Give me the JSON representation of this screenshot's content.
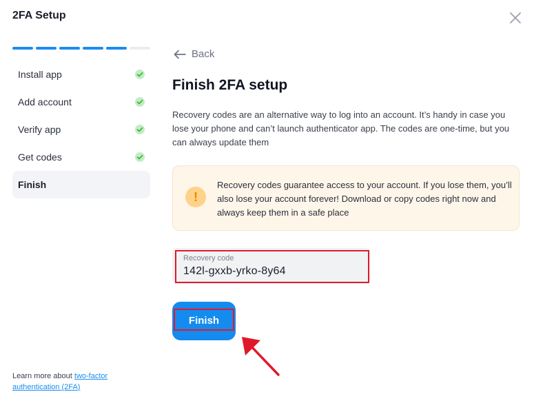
{
  "modal": {
    "title": "2FA Setup"
  },
  "progress": {
    "segments_total": 6,
    "segments_done": 5,
    "accent": "#1a8cf0"
  },
  "steps": [
    {
      "label": "Install app",
      "done": true
    },
    {
      "label": "Add account",
      "done": true
    },
    {
      "label": "Verify app",
      "done": true
    },
    {
      "label": "Get codes",
      "done": true
    },
    {
      "label": "Finish",
      "done": false,
      "active": true
    }
  ],
  "learn_more": {
    "prefix": "Learn more about ",
    "link": "two-factor authentication (2FA)"
  },
  "main": {
    "back_label": "Back",
    "title": "Finish 2FA setup",
    "description": "Recovery codes are an alternative way to log into an account. It’s handy in case you lose your phone and can’t launch authenticator app. The codes are one-time, but you can always update them",
    "warning": {
      "icon": "exclamation-icon",
      "text": "Recovery codes guarantee access to your account. If you lose them, you’ll also lose your account forever! Download or copy codes right now and always keep them in a safe place"
    },
    "recovery": {
      "label": "Recovery code",
      "value": "142l-gxxb-yrko-8y64"
    },
    "finish_label": "Finish"
  },
  "colors": {
    "primary": "#148bef",
    "highlight": "#e0192a",
    "warning_bg": "#fff6ea",
    "success": "#3cb93c"
  }
}
